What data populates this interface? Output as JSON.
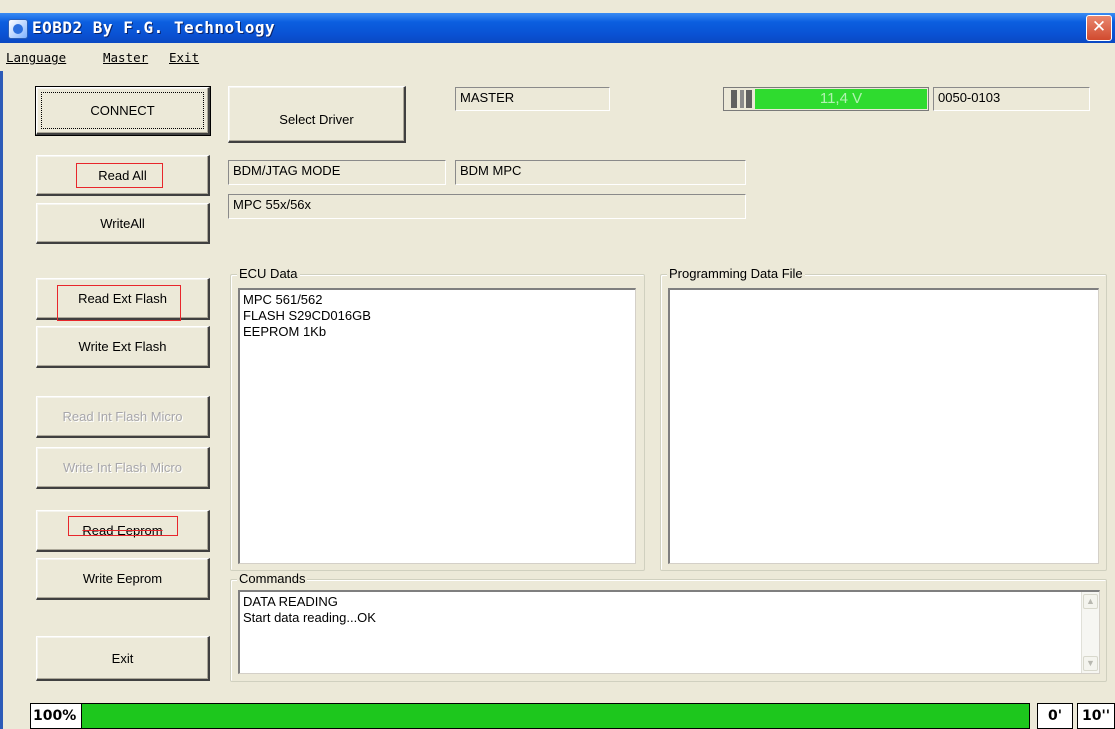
{
  "window": {
    "title": "EOBD2 By F.G. Technology",
    "close_glyph": "✕"
  },
  "menu": [
    "Language",
    "Master",
    "Exit"
  ],
  "buttons": {
    "connect": "CONNECT",
    "read_all": "Read All",
    "write_all": "WriteAll",
    "read_ext_flash": "Read Ext Flash",
    "write_ext_flash": "Write Ext Flash",
    "read_int_flash": "Read Int Flash Micro",
    "write_int_flash": "Write Int Flash Micro",
    "read_eeprom": "Read Eeprom",
    "write_eeprom": "Write Eeprom",
    "exit": "Exit",
    "select_driver": "Select Driver"
  },
  "fields": {
    "master": "MASTER",
    "voltage": "11,4 V",
    "version": "0050-0103",
    "mode": "BDM/JTAG  MODE",
    "protocol": "BDM MPC",
    "mcu_family": "MPC 55x/56x"
  },
  "ecu_data": {
    "label": "ECU Data",
    "lines": [
      "MPC 561/562",
      "FLASH S29CD016GB",
      "EEPROM  1Kb"
    ]
  },
  "programming_file": {
    "label": "Programming Data File",
    "lines": []
  },
  "commands": {
    "label": "Commands",
    "lines": [
      "DATA READING",
      "Start data reading...OK"
    ]
  },
  "status": {
    "percent": "100%",
    "progress": 1.0,
    "minutes": "0'",
    "seconds": "10''"
  },
  "colors": {
    "titlebar": "#0A52D4",
    "voltage_bar": "#2FDB2F",
    "progress": "#1DC71D",
    "highlight_box": "#E8262B"
  }
}
